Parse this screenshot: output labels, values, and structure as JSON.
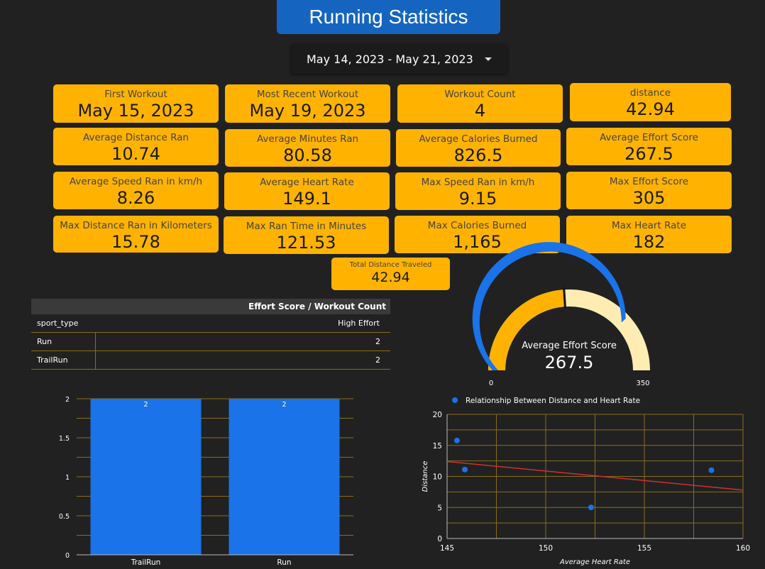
{
  "title": "Running Statistics",
  "date_range": "May 14, 2023 - May 21, 2023",
  "cards": [
    {
      "label": "First Workout",
      "value": "May 15, 2023"
    },
    {
      "label": "Most Recent Workout",
      "value": "May 19, 2023"
    },
    {
      "label": "Workout Count",
      "value": "4"
    },
    {
      "label": "distance",
      "value": "42.94"
    },
    {
      "label": "Average Distance Ran",
      "value": "10.74"
    },
    {
      "label": "Average Minutes Ran",
      "value": "80.58"
    },
    {
      "label": "Average Calories Burned",
      "value": "826.5"
    },
    {
      "label": "Average Effort Score",
      "value": "267.5"
    },
    {
      "label": "Average Speed Ran in km/h",
      "value": "8.26"
    },
    {
      "label": "Average Heart Rate",
      "value": "149.1"
    },
    {
      "label": "Max Speed Ran in km/h",
      "value": "9.15"
    },
    {
      "label": "Max Effort Score",
      "value": "305"
    },
    {
      "label": "Max Distance Ran in Kilometers",
      "value": "15.78"
    },
    {
      "label": "Max Ran Time in Minutes",
      "value": "121.53"
    },
    {
      "label": "Max Calories Burned",
      "value": "1,165"
    },
    {
      "label": "Max Heart Rate",
      "value": "182"
    },
    {
      "label": "Total Distance Traveled",
      "value": "42.94"
    }
  ],
  "table": {
    "title": "Effort Score / Workout Count",
    "col1": "sport_type",
    "col2": "High Effort",
    "rows": [
      {
        "type": "Run",
        "value": "2"
      },
      {
        "type": "TrailRun",
        "value": "2"
      }
    ]
  },
  "colors": {
    "accent": "#ffb300",
    "blue": "#1a73e8",
    "title_bg": "#1565c0",
    "trend": "#d32f2f"
  },
  "chart_data": [
    {
      "type": "bar",
      "categories": [
        "TrailRun",
        "Run"
      ],
      "values": [
        2,
        2
      ],
      "ylim": [
        0,
        2
      ],
      "yticks": [
        "0",
        "0.5",
        "1",
        "1.5",
        "2"
      ],
      "data_labels": [
        "2",
        "2"
      ]
    },
    {
      "type": "gauge",
      "label": "Average Effort Score",
      "value": 267.5,
      "value_label": "267.5",
      "min": 0,
      "max": 350,
      "min_label": "0",
      "max_label": "350",
      "target": 305
    },
    {
      "type": "scatter",
      "legend": "Relationship Between Distance and Heart Rate",
      "xlabel": "Average Heart Rate",
      "ylabel": "Distance",
      "xlim": [
        145,
        160
      ],
      "ylim": [
        0,
        20
      ],
      "xticks": [
        "145",
        "150",
        "155",
        "160"
      ],
      "yticks": [
        "0",
        "5",
        "10",
        "15",
        "20"
      ],
      "points": [
        {
          "x": 145.5,
          "y": 15.78
        },
        {
          "x": 145.9,
          "y": 11.1
        },
        {
          "x": 152.3,
          "y": 5.0
        },
        {
          "x": 158.4,
          "y": 11.0
        }
      ],
      "trendline": {
        "x": [
          145,
          160
        ],
        "y": [
          12.4,
          7.8
        ]
      }
    }
  ]
}
